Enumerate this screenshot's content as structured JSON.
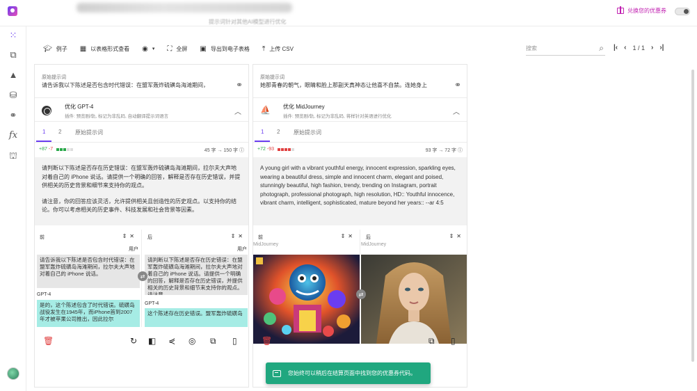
{
  "header": {
    "blurred_subtitle": "提示词针对其他AI模型进行优化",
    "coupon_label": "兑换您的优惠券"
  },
  "sidebar": {
    "items": [
      {
        "icon": "grid-dots-icon",
        "glyph": "⁙"
      },
      {
        "icon": "hierarchy-icon",
        "glyph": "⧉"
      },
      {
        "icon": "shapes-icon",
        "glyph": "▲"
      },
      {
        "icon": "database-icon",
        "glyph": "⛁"
      },
      {
        "icon": "webhook-icon",
        "glyph": "⚭"
      },
      {
        "icon": "function-icon",
        "glyph": "fx"
      },
      {
        "icon": "robot-icon",
        "glyph": "⛫"
      }
    ]
  },
  "toolbar": {
    "examples": "例子",
    "table_view": "以表格形式查看",
    "fullscreen": "全屏",
    "export_sheet": "导出到电子表格",
    "upload_csv": "上传 CSV"
  },
  "search": {
    "placeholder": "搜索"
  },
  "pager": {
    "page": "1 / 1"
  },
  "columns": [
    {
      "orig_label": "原始提示词",
      "orig_text": "请告诉我以下陈述是否包含时代错误：在盟军轰炸硫磺岛海滩期间，",
      "opt_title": "优化 GPT-4",
      "opt_sub": "插件: 预览剧/轨, 标记为非乱码, 自动翻译提示词语言",
      "tabs": [
        "1",
        "2",
        "原始提示词"
      ],
      "diff_plus": "+87",
      "diff_minus": "-7",
      "chars": "45 字 → 150 字",
      "result_p1": "请判断以下陈述是否存在历史错误：在盟军轰炸硫磺岛海滩期间，拉尔夫大声地对着自己的 iPhone 说话。请提供一个明确的回答，解释是否存在历史错误，并提供相关的历史背景和细节来支持你的观点。",
      "result_p2": "请注意，你的回答应该灵活，允许提供相关且创造性的历史观点。以支持你的结论。你可以考虑相关的历史事件、科技发展和社会背景等因素。",
      "before_label": "前",
      "after_label": "后",
      "role_label": "用户",
      "before_user": "请告诉我以下陈述是否包含时代错误：在盟军轰炸硫磺岛海滩期间，拉尔夫大声地对着自己的 iPhone 说话。",
      "after_user": "请判断以下陈述是否存在历史错误：在盟军轰炸硫磺岛海滩期间，拉尔夫大声地对着自己的 iPhone 说话。请提供一个明确的回答，解释是否存在历史错误，并提供相关的历史背景和细节来支持你的观点。请注意，",
      "model_label": "GPT-4",
      "before_reply": "是的，这个陈述包含了时代错误。硫磺岛战役发生在1945年，而iPhone首到2007年才被苹果公司推出，因此拉尔",
      "after_reply": "这个陈述存在历史错误。盟军轰炸硫磺岛"
    },
    {
      "orig_label": "原始提示词",
      "orig_text": "她那青春的朝气，眼睛和脸上那副天真神态让他喜不自禁。连她身上",
      "opt_title": "优化 MidJourney",
      "opt_sub": "插件: 预览剧/轨, 标记为非乱码, 将样针对英语进行优化",
      "tabs": [
        "1",
        "2",
        "原始提示词"
      ],
      "diff_plus": "+72",
      "diff_minus": "-93",
      "chars": "93 字 → 72 字",
      "result_p1": "A young girl with a vibrant youthful energy, innocent expression, sparkling eyes, wearing a beautiful dress, simple and innocent charm, elegant and poised, stunningly beautiful, high fashion, trendy, trending on Instagram, portrait photograph, professional photograph, high resolution, HD:: Youthful innocence, vibrant charm, intelligent, sophisticated, mature beyond her years:: --ar 4:5",
      "before_label": "前",
      "after_label": "后",
      "model_label": "MidJourney"
    }
  ],
  "toast": {
    "text": "您始终可以稍后在结算页面中找到您的优惠券代码。"
  },
  "colors": {
    "accent": "#6a3df0",
    "toast": "#20a77f",
    "cyan_bubble": "#a6ece5",
    "danger": "#e04040",
    "coupon": "#c020b0"
  }
}
